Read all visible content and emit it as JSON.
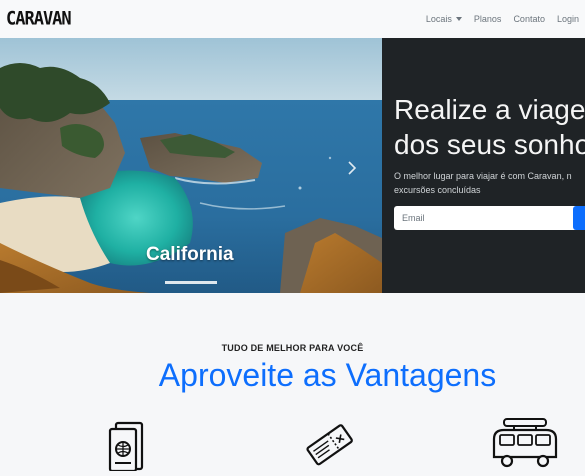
{
  "navbar": {
    "brand": "CARAVAN",
    "links": [
      {
        "label": "Locais",
        "dropdown": true
      },
      {
        "label": "Planos"
      },
      {
        "label": "Contato"
      },
      {
        "label": "Login"
      }
    ]
  },
  "hero": {
    "carousel": {
      "caption": "California",
      "next_icon": "chevron-right-icon"
    },
    "title_line1": "Realize a viagem",
    "title_line2": "dos seus sonhos",
    "subtitle_line1": "O melhor lugar para viajar é com Caravan, n",
    "subtitle_line2": "excursões concluídas",
    "email_placeholder": "Email"
  },
  "benefits": {
    "eyebrow": "TUDO DE MELHOR PARA VOCÊ",
    "title": "Aproveite as Vantagens",
    "features": [
      {
        "icon": "passport-icon"
      },
      {
        "icon": "ticket-icon"
      },
      {
        "icon": "van-icon"
      }
    ]
  },
  "colors": {
    "accent": "#0d6efd",
    "dark_panel": "#1f2326",
    "navbar_bg": "#f8f9fa"
  }
}
